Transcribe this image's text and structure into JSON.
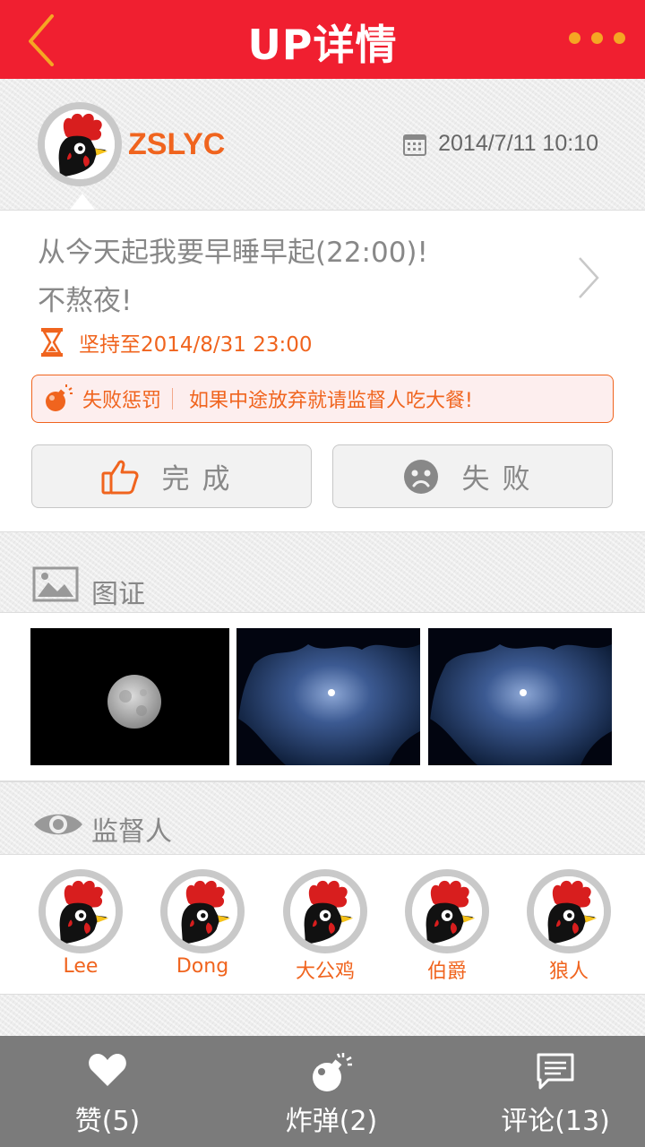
{
  "header": {
    "title": "UP详情"
  },
  "post": {
    "user_name": "ZSLYC",
    "datetime": "2014/7/11 10:10",
    "goal_line1": "从今天起我要早睡早起(22:00)!",
    "goal_line2": "不熬夜!",
    "deadline": "坚持至2014/8/31 23:00",
    "penalty_label": "失败惩罚",
    "penalty_text": "如果中途放弃就请监督人吃大餐!",
    "done_label": "完成",
    "fail_label": "失败"
  },
  "photos": {
    "title": "图证"
  },
  "supervisors": {
    "title": "监督人",
    "list": [
      "Lee",
      "Dong",
      "大公鸡",
      "伯爵",
      "狼人"
    ]
  },
  "bottom_bar": {
    "like_label": "赞(5)",
    "bomb_label": "炸弹(2)",
    "comment_label": "评论(13)"
  },
  "colors": {
    "header_red": "#f01f30",
    "accent_orange": "#f0641e",
    "bottom_gray": "#7b7b7b"
  },
  "icons": [
    "back-arrow-icon",
    "more-dots-icon",
    "calendar-icon",
    "hourglass-icon",
    "bomb-icon",
    "thumbs-up-icon",
    "sad-face-icon",
    "image-icon",
    "eye-icon",
    "heart-icon",
    "comment-icon"
  ]
}
